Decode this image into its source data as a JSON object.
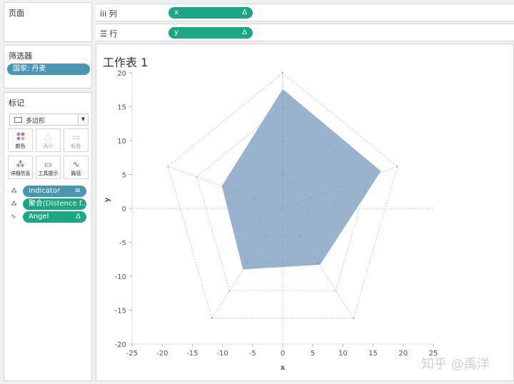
{
  "pages_panel": {
    "title": "页面"
  },
  "filters_panel": {
    "title": "筛选器",
    "filter_pill": "国家: 丹麦"
  },
  "marks_panel": {
    "title": "标记",
    "mark_type": "多边形",
    "buttons": [
      {
        "label": "颜色",
        "icon": "color-dots-icon"
      },
      {
        "label": "大小",
        "icon": "size-icon"
      },
      {
        "label": "标签",
        "icon": "label-icon"
      },
      {
        "label": "详细信息",
        "icon": "detail-icon"
      },
      {
        "label": "工具提示",
        "icon": "tooltip-icon"
      },
      {
        "label": "路径",
        "icon": "path-icon"
      }
    ],
    "fields": [
      {
        "label": "Indicator",
        "kind": "dimension",
        "icon": "detail-icon"
      },
      {
        "label": "聚合(Distence f...",
        "kind": "measure",
        "icon": "detail-icon"
      },
      {
        "label": "Angel",
        "kind": "measure",
        "icon": "path-icon",
        "badge": "Δ"
      }
    ]
  },
  "columns_shelf": {
    "label": "列",
    "pill": "x",
    "badge": "Δ",
    "icon": "columns-icon"
  },
  "rows_shelf": {
    "label": "行",
    "pill": "y",
    "badge": "Δ",
    "icon": "rows-icon"
  },
  "sheet": {
    "title": "工作表 1"
  },
  "colors": {
    "pill_blue": "#4996b2",
    "pill_green": "#1aa782",
    "polygon_fill": "#7f9fc2"
  },
  "chart_data": {
    "type": "area",
    "xlabel": "x",
    "ylabel": "y",
    "xlim": [
      -25,
      25
    ],
    "ylim": [
      -20,
      20
    ],
    "x_ticks": [
      -25,
      -20,
      -15,
      -10,
      -5,
      0,
      5,
      10,
      15,
      20,
      25
    ],
    "y_ticks": [
      20,
      15,
      10,
      5,
      0,
      -5,
      -10,
      -15,
      -20
    ],
    "polygon": [
      {
        "x": 0,
        "y": 17.6
      },
      {
        "x": 16.3,
        "y": 5.5
      },
      {
        "x": 6.2,
        "y": -8.3
      },
      {
        "x": -6.6,
        "y": -9.0
      },
      {
        "x": -10.1,
        "y": 3.3
      }
    ],
    "grid_pentagon_radii": [
      5,
      10,
      15,
      20
    ],
    "grid_angles_deg": [
      90,
      18,
      -54,
      -126,
      162
    ]
  },
  "watermark": "知乎 @禹洋"
}
